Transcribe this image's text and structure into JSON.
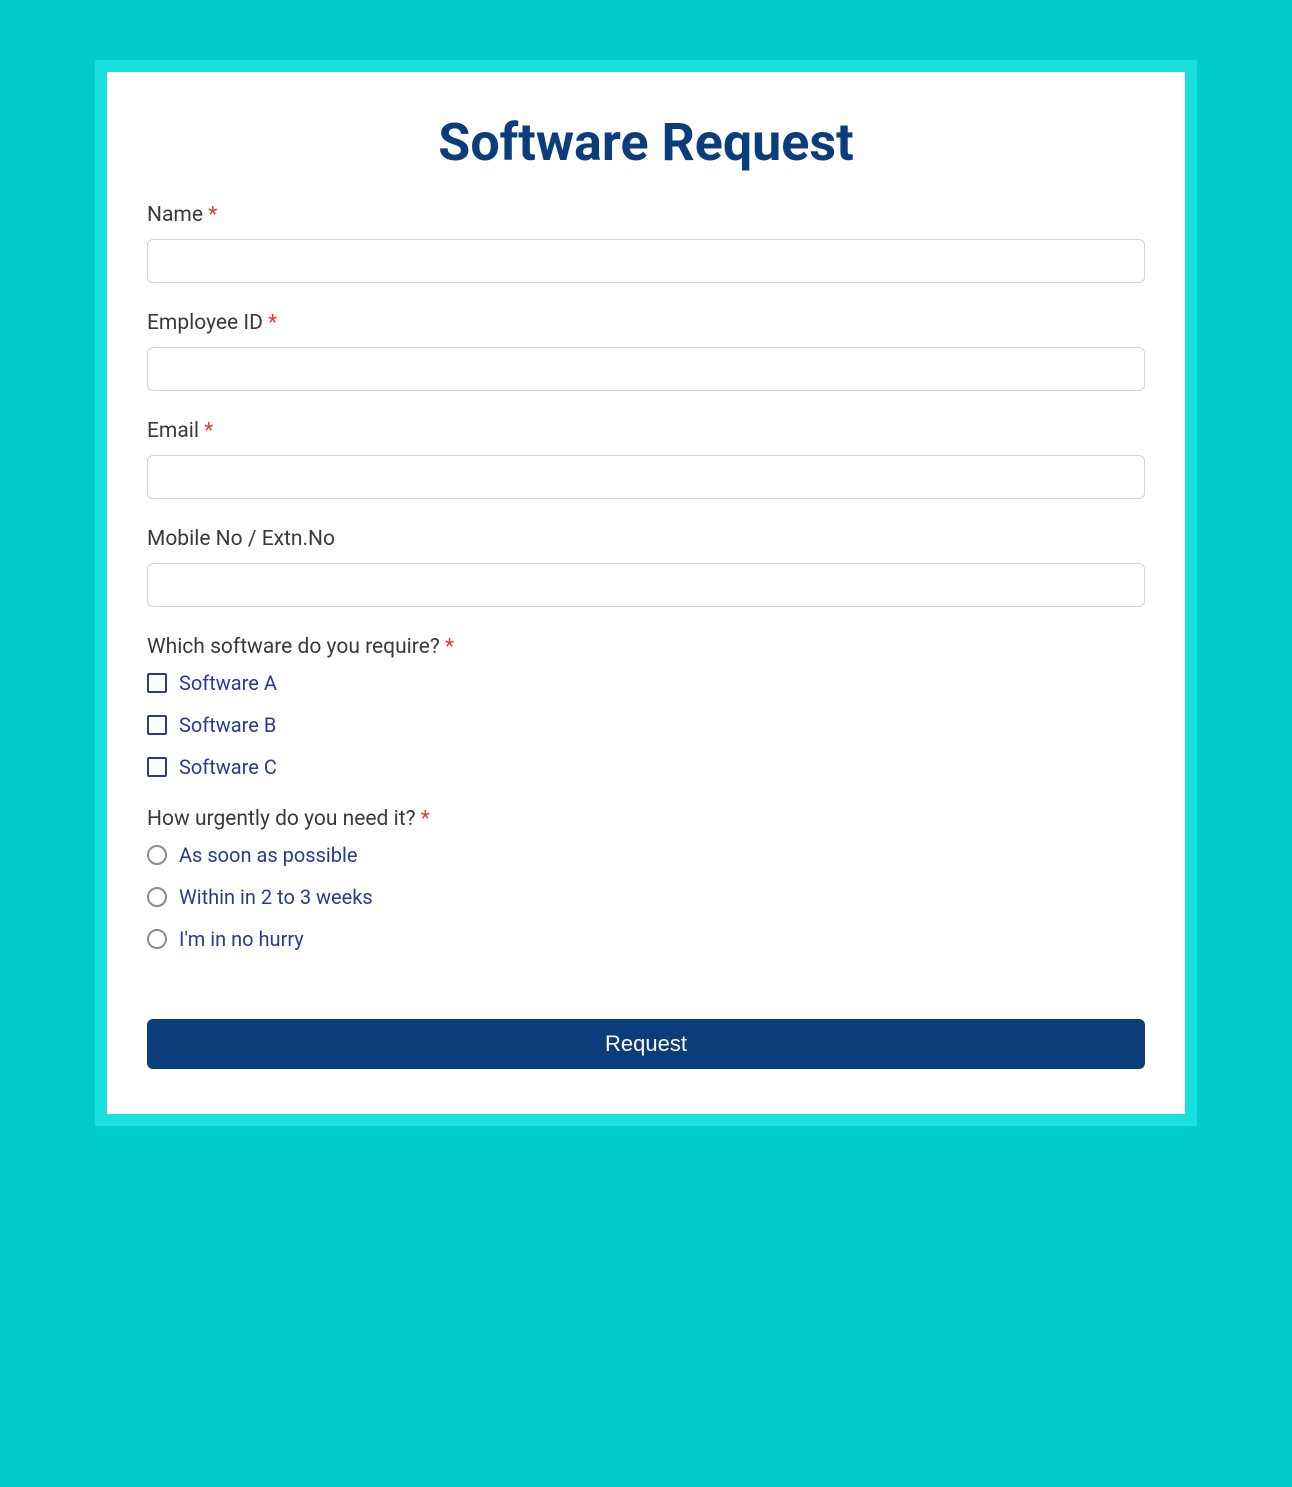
{
  "form": {
    "title": "Software Request",
    "fields": {
      "name": {
        "label": "Name",
        "required": true,
        "value": ""
      },
      "employee_id": {
        "label": "Employee ID",
        "required": true,
        "value": ""
      },
      "email": {
        "label": "Email",
        "required": true,
        "value": ""
      },
      "mobile": {
        "label": "Mobile No / Extn.No",
        "required": false,
        "value": ""
      },
      "software": {
        "label": "Which software do you require?",
        "required": true,
        "options": [
          "Software A",
          "Software B",
          "Software C"
        ]
      },
      "urgency": {
        "label": "How urgently do you need it?",
        "required": true,
        "options": [
          "As soon as possible",
          "Within in 2 to 3 weeks",
          "I'm in no hurry"
        ]
      }
    },
    "required_marker": "*",
    "submit_label": "Request"
  }
}
